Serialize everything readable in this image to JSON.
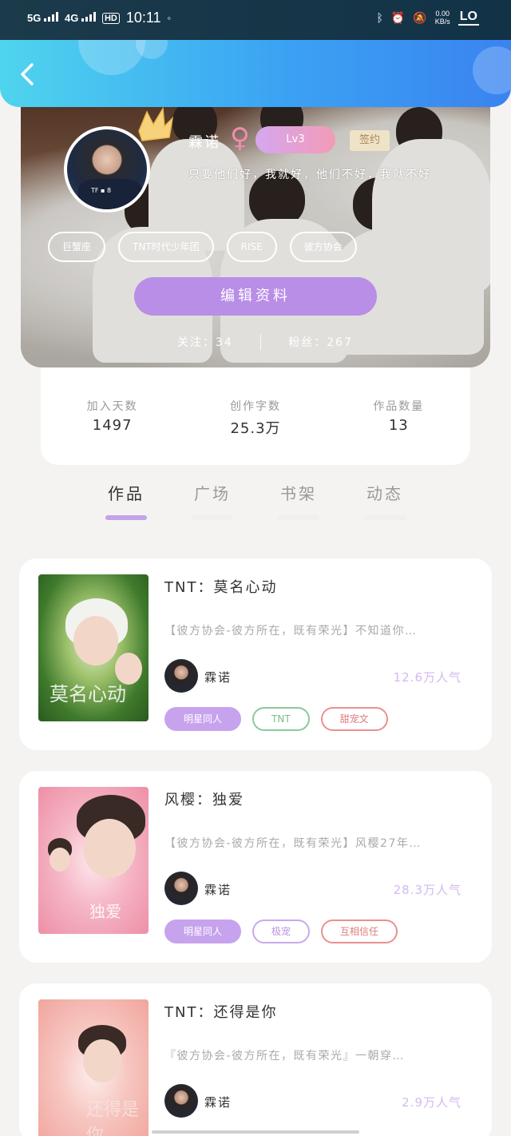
{
  "status_bar": {
    "network_1": "5G",
    "network_2": "4G",
    "hd": "HD",
    "time": "10:11",
    "speed_value": "0.00",
    "speed_unit": "KB/s",
    "battery_label": "LO"
  },
  "profile": {
    "name": "霖诺",
    "gender_icon": "♀",
    "level": "Lv3",
    "signed_badge": "签约",
    "motto": "只要他们好，我就好，他们不好，我就不好",
    "tags": [
      "巨蟹座",
      "TNT时代少年团",
      "RISE",
      "彼方协会"
    ],
    "edit_button": "编辑资料",
    "following_label": "关注：34",
    "followers_label": "粉丝：267"
  },
  "stats": [
    {
      "label": "加入天数",
      "value": "1497"
    },
    {
      "label": "创作字数",
      "value": "25.3万"
    },
    {
      "label": "作品数量",
      "value": "13"
    }
  ],
  "tabs": [
    {
      "label": "作品",
      "active": true
    },
    {
      "label": "广场",
      "active": false
    },
    {
      "label": "书架",
      "active": false
    },
    {
      "label": "动态",
      "active": false
    }
  ],
  "works": [
    {
      "title": "TNT：莫名心动",
      "desc": "【彼方协会-彼方所在，既有荣光】不知道你…",
      "author": "霖诺",
      "popularity": "12.6万人气",
      "tags": [
        "明星同人",
        "TNT",
        "甜宠文"
      ],
      "cover_text": "莫名心动"
    },
    {
      "title": "风樱：独爱",
      "desc": "【彼方协会-彼方所在，既有荣光】风樱27年…",
      "author": "霖诺",
      "popularity": "28.3万人气",
      "tags": [
        "明星同人",
        "极宠",
        "互相信任"
      ],
      "cover_text": "独爱"
    },
    {
      "title": "TNT：还得是你",
      "desc": "『彼方协会-彼方所在，既有荣光』一朝穿…",
      "author": "霖诺",
      "popularity": "2.9万人气",
      "tags": [],
      "cover_text": "还得是你"
    }
  ],
  "colors": {
    "header_start": "#4fd4ee",
    "header_end": "#3a83f0",
    "accent_purple": "#b98ee6",
    "tab_indicator": "#c4a3e7"
  }
}
